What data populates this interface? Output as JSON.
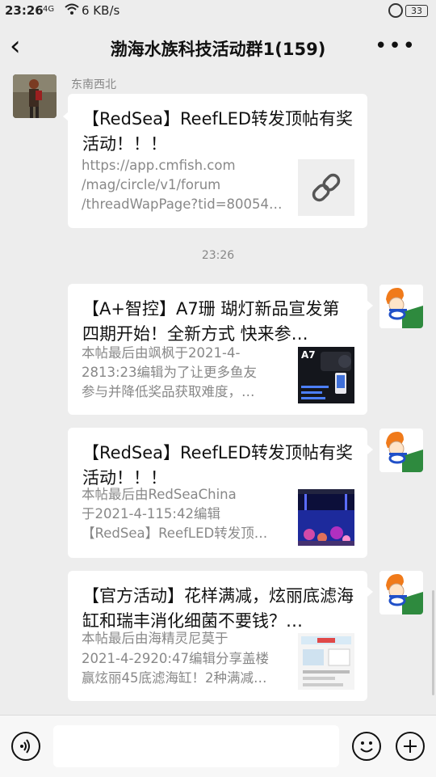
{
  "status_bar": {
    "time": "23:26",
    "signal_label": "4G",
    "speed": "6 KB/s",
    "battery": "33"
  },
  "header": {
    "back_icon": "‹",
    "title": "渤海水族科技活动群1(159)",
    "more_icon": "•••"
  },
  "messages": [
    {
      "sender": "东南西北",
      "title": "【RedSea】ReefLED转发顶帖有奖活动！！！",
      "desc_lines": [
        "https://app.cmfish.com",
        "/mag/circle/v1/forum",
        "/threadWapPage?tid=80054…"
      ],
      "thumb_icon": "link-icon"
    },
    {
      "title": "【A+智控】A7珊 瑚灯新品宣发第四期开始！全新方式 快来参…",
      "desc_lines": [
        "本帖最后由飒枫于2021-4-",
        "2813:23编辑为了让更多鱼友",
        "参与并降低奖品获取难度，…"
      ],
      "thumb_label": "A7"
    },
    {
      "title": "【RedSea】ReefLED转发顶帖有奖活动！！！",
      "desc_lines": [
        "本帖最后由RedSeaChina",
        "于2021-4-115:42编辑",
        "【RedSea】ReefLED转发顶…"
      ]
    },
    {
      "title": "【官方活动】花样满减，炫丽底滤海缸和瑞丰消化细菌不要钱？…",
      "desc_lines": [
        "本帖最后由海精灵尼莫于",
        "2021-4-2920:47编辑分享盖楼",
        "赢炫丽45底滤海缸！2种满减…"
      ]
    }
  ],
  "timestamp": "23:26",
  "colors": {
    "background": "#ededed",
    "card": "#ffffff",
    "muted_text": "#888888"
  }
}
